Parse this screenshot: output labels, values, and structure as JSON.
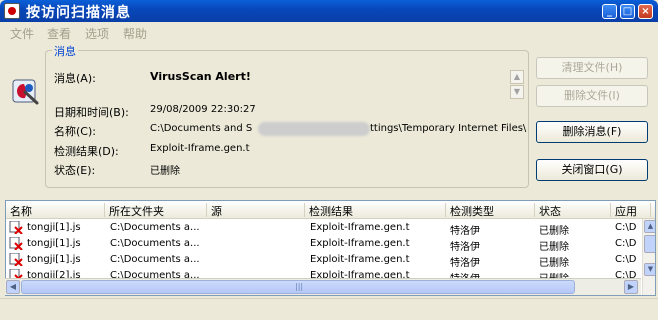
{
  "window": {
    "title": "按访问扫描消息",
    "buttons": {
      "minimize": "_",
      "maximize": "□",
      "close": "×"
    }
  },
  "menu": {
    "items": [
      {
        "label": "文件"
      },
      {
        "label": "查看"
      },
      {
        "label": "选项"
      },
      {
        "label": "帮助"
      }
    ]
  },
  "group": {
    "legend": "消息"
  },
  "fields": {
    "message_label": "消息(A):",
    "message_value": "VirusScan Alert!",
    "datetime_label": "日期和时间(B):",
    "datetime_value": "29/08/2009 22:30:27",
    "name_label": "名称(C):",
    "name_value": "C:\\Documents and S",
    "name_value_tail": "ttings\\Temporary Internet Files\\",
    "result_label": "检测结果(D):",
    "result_value": "Exploit-Iframe.gen.t",
    "status_label": "状态(E):",
    "status_value": "已删除"
  },
  "buttons": {
    "clean_file": "清理文件(H)",
    "delete_file": "删除文件(I)",
    "delete_message": "删除消息(F)",
    "close_window": "关闭窗口(G)"
  },
  "list": {
    "columns": [
      "名称",
      "所在文件夹",
      "源",
      "检测结果",
      "检测类型",
      "状态",
      "应用"
    ],
    "rows": [
      {
        "name": "tongji[1].js",
        "folder": "C:\\Documents a...",
        "source": "",
        "result": "Exploit-Iframe.gen.t",
        "type": "特洛伊",
        "status": "已删除",
        "app": "C:\\D"
      },
      {
        "name": "tongji[1].js",
        "folder": "C:\\Documents a...",
        "source": "",
        "result": "Exploit-Iframe.gen.t",
        "type": "特洛伊",
        "status": "已删除",
        "app": "C:\\D"
      },
      {
        "name": "tongji[1].js",
        "folder": "C:\\Documents a...",
        "source": "",
        "result": "Exploit-Iframe.gen.t",
        "type": "特洛伊",
        "status": "已删除",
        "app": "C:\\D"
      },
      {
        "name": "tongji[2].js",
        "folder": "C:\\Documents a...",
        "source": "",
        "result": "Exploit-Iframe.gen.t",
        "type": "特洛伊",
        "status": "已删除",
        "app": "C:\\D"
      }
    ]
  },
  "icons": {
    "app": "virusscan-icon",
    "alert": "virus-alert-icon",
    "row": "infected-file-icon"
  },
  "colors": {
    "titlebar": "#0846b8",
    "legend": "#0046d5",
    "disabled_text": "#aca899"
  }
}
